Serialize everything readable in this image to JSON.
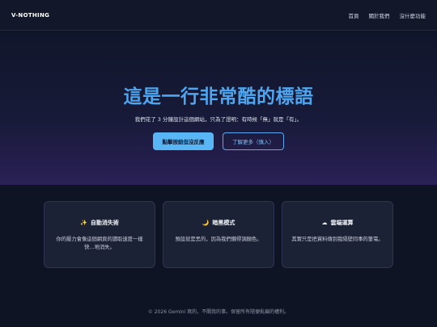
{
  "nav": {
    "brand": "V-NOTHING",
    "links": [
      "首頁",
      "關於我們",
      "沒什麼功能"
    ]
  },
  "hero": {
    "title": "這是一行非常酷的標語",
    "subtitle": "我們花了 3 分鐘設計這個網站，只為了證明：有時候「無」就是「有」。",
    "primary_button": "點擊按鈕但沒反應",
    "secondary_button": "了解更多（慎入）"
  },
  "features": [
    {
      "icon": "sparkles-icon",
      "glyph": "✨",
      "title": "自動消失術",
      "desc": "你的壓力會像這個網頁的讀取速度一樣快…地消失。"
    },
    {
      "icon": "moon-icon",
      "glyph": "🌙",
      "title": "暗黑模式",
      "desc": "預設就是黑的，因為我們懶得調顏色。"
    },
    {
      "icon": "cloud-icon",
      "glyph": "☁",
      "title": "雲端運算",
      "desc": "其實只是把資料傳到我隔壁同事的筆電。"
    }
  ],
  "footer": "© 2026 Gemini 寫的，不關我的事。保留所有隨便亂編的權利。",
  "colors": {
    "background": "#0f1424",
    "accent": "#4fa6f0",
    "primary_button": "#58b6f4",
    "card": "#1c2236"
  }
}
